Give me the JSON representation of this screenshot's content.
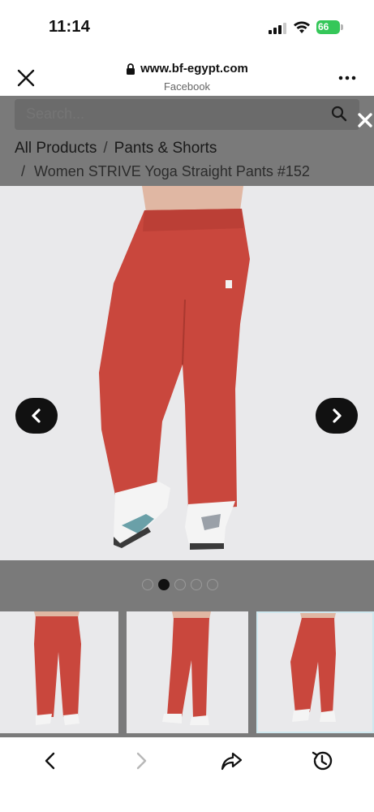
{
  "status_bar": {
    "time": "11:14",
    "battery": "66",
    "icons": [
      "cellular-signal-icon",
      "wifi-icon",
      "battery-charging-icon"
    ]
  },
  "browser_header": {
    "url": "www.bf-egypt.com",
    "source": "Facebook",
    "icons": [
      "close-icon",
      "lock-icon",
      "more-icon"
    ]
  },
  "search": {
    "placeholder": "Search..."
  },
  "breadcrumb": {
    "items": [
      "All Products",
      "Pants & Shorts"
    ],
    "separator": "/",
    "current": "Women STRIVE Yoga Straight Pants #152"
  },
  "product": {
    "pants_color": "#c9473d",
    "carousel_active_index": 2,
    "carousel_total": 5
  },
  "thumbnails": {
    "count": 3,
    "selected_index": 3
  },
  "toolbar": {
    "icons": [
      "back-icon",
      "forward-icon",
      "share-icon",
      "history-icon"
    ]
  },
  "colors": {
    "overlay": "#7a7a7a",
    "battery_green": "#35c759",
    "carousel_button": "#111111"
  }
}
